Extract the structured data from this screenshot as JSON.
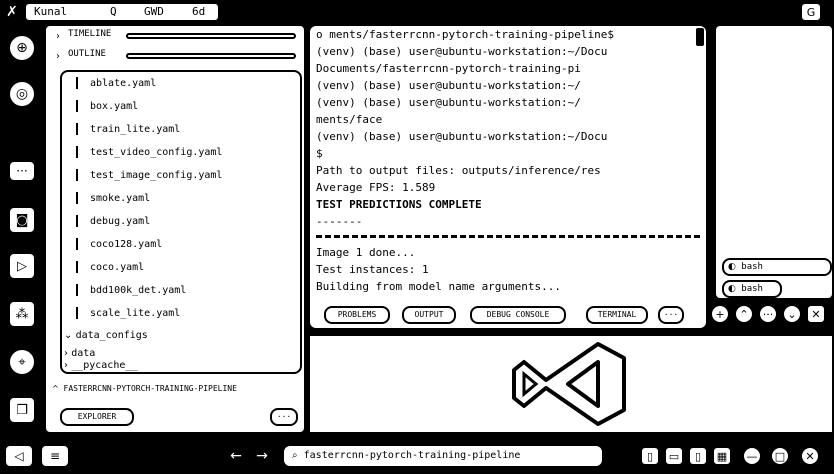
{
  "menubar": {
    "items": [
      "Kunal",
      "Q",
      "GWD",
      "6d"
    ],
    "app_glyph": "✗",
    "right_glyph": "G"
  },
  "explorer": {
    "timeline_label": "TIMELINE",
    "outline_label": "OUTLINE",
    "files": [
      "ablate.yaml",
      "box.yaml",
      "train_lite.yaml",
      "test_video_config.yaml",
      "test_image_config.yaml",
      "smoke.yaml",
      "debug.yaml",
      "coco128.yaml",
      "coco.yaml",
      "bdd100k_det.yaml",
      "scale_lite.yaml"
    ],
    "folders": [
      "data_configs",
      "data",
      "__pycache__"
    ],
    "section_label": "FASTERRCNN-PYTORCH-TRAINING-PIPELINE",
    "bottom_button": "EXPLORER",
    "more": "···"
  },
  "terminal": {
    "lines": [
      "o ments/fasterrcnn-pytorch-training-pipeline$",
      "(venv) (base) user@ubuntu-workstation:~/Docu",
      "Documents/fasterrcnn-pytorch-training-pi",
      "(venv) (base) user@ubuntu-workstation:~/",
      "(venv) (base) user@ubuntu-workstation:~/",
      "ments/face",
      "(venv) (base) user@ubuntu-workstation:~/Docu",
      "$",
      "Path to output files: outputs/inference/res",
      "Average FPS: 1.589",
      "TEST PREDICTIONS COMPLETE",
      "-------",
      "",
      "Image 1 done...",
      "Test instances: 1",
      "Building from model name arguments..."
    ],
    "tabs": [
      "PROBLEMS",
      "OUTPUT",
      "DEBUG CONSOLE",
      "TERMINAL"
    ],
    "tab_more": "···"
  },
  "right_panel": {
    "items": [
      "bash",
      "bash"
    ]
  },
  "statusbar": {
    "search_text": "fasterrcnn-pytorch-training-pipeline",
    "nav_back": "←",
    "nav_forward": "→"
  },
  "colors": {
    "ink": "#000000",
    "paper": "#ffffff"
  }
}
